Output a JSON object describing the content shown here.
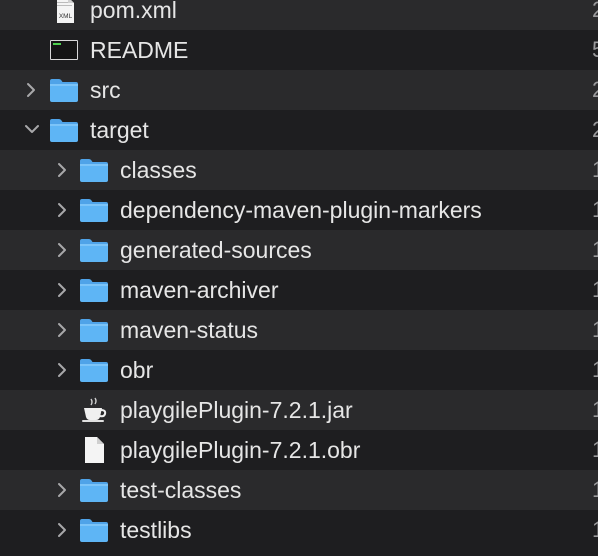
{
  "files": [
    {
      "name": "pom.xml",
      "kind": "xml",
      "level": 0,
      "expandable": false,
      "expanded": false,
      "trailing": "2"
    },
    {
      "name": "README",
      "kind": "exec",
      "level": 0,
      "expandable": false,
      "expanded": false,
      "trailing": "5"
    },
    {
      "name": "src",
      "kind": "folder",
      "level": 0,
      "expandable": true,
      "expanded": false,
      "trailing": "2"
    },
    {
      "name": "target",
      "kind": "folder",
      "level": 0,
      "expandable": true,
      "expanded": true,
      "trailing": "2"
    },
    {
      "name": "classes",
      "kind": "folder",
      "level": 1,
      "expandable": true,
      "expanded": false,
      "trailing": "1"
    },
    {
      "name": "dependency-maven-plugin-markers",
      "kind": "folder",
      "level": 1,
      "expandable": true,
      "expanded": false,
      "trailing": "1"
    },
    {
      "name": "generated-sources",
      "kind": "folder",
      "level": 1,
      "expandable": true,
      "expanded": false,
      "trailing": "1"
    },
    {
      "name": "maven-archiver",
      "kind": "folder",
      "level": 1,
      "expandable": true,
      "expanded": false,
      "trailing": "1"
    },
    {
      "name": "maven-status",
      "kind": "folder",
      "level": 1,
      "expandable": true,
      "expanded": false,
      "trailing": "1"
    },
    {
      "name": "obr",
      "kind": "folder",
      "level": 1,
      "expandable": true,
      "expanded": false,
      "trailing": "1"
    },
    {
      "name": "playgilePlugin-7.2.1.jar",
      "kind": "jar",
      "level": 1,
      "expandable": false,
      "expanded": false,
      "trailing": "1"
    },
    {
      "name": "playgilePlugin-7.2.1.obr",
      "kind": "file",
      "level": 1,
      "expandable": false,
      "expanded": false,
      "trailing": "1"
    },
    {
      "name": "test-classes",
      "kind": "folder",
      "level": 1,
      "expandable": true,
      "expanded": false,
      "trailing": "1"
    },
    {
      "name": "testlibs",
      "kind": "folder",
      "level": 1,
      "expandable": true,
      "expanded": false,
      "trailing": "1"
    }
  ],
  "icons": {
    "folder": "folder-icon",
    "xml": "xml-file-icon",
    "exec": "terminal-executable-icon",
    "jar": "java-jar-icon",
    "file": "document-icon"
  },
  "colors": {
    "row_dark": "#1e1e20",
    "row_light": "#2a2a2c",
    "text": "#e6e6e6",
    "folder": "#5eb5f5"
  }
}
